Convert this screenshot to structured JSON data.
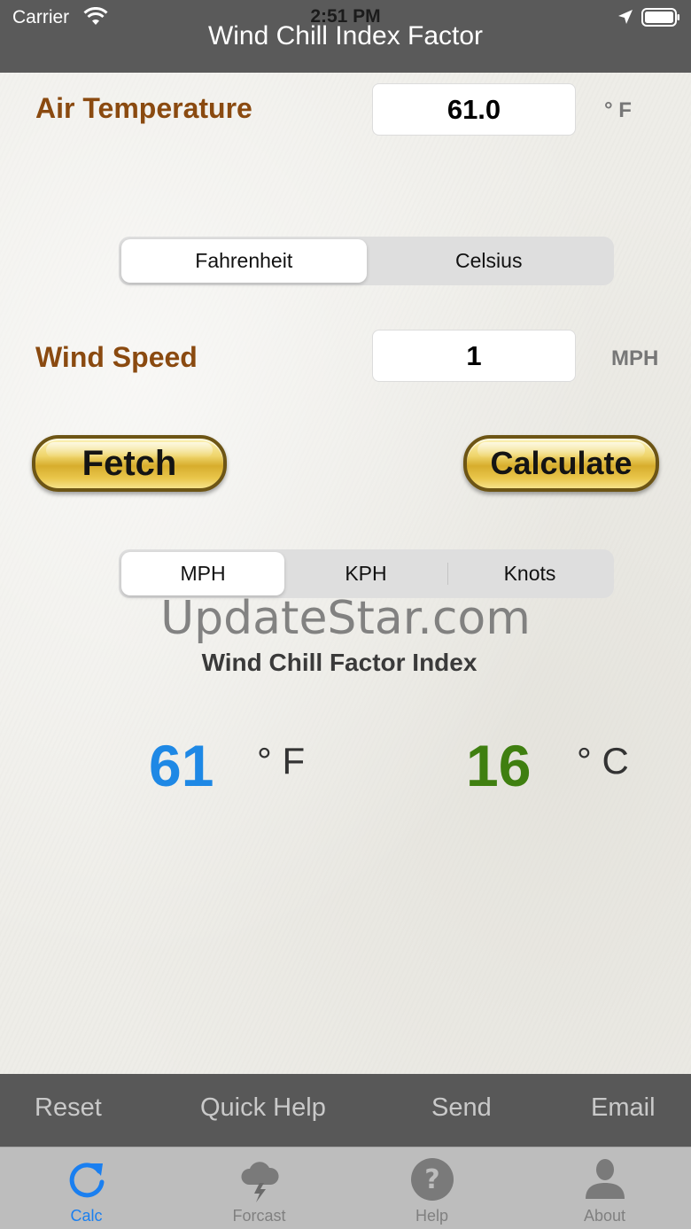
{
  "status_bar": {
    "carrier": "Carrier",
    "time": "2:51 PM"
  },
  "nav": {
    "title": "Wind Chill Index Factor"
  },
  "air_temperature": {
    "label": "Air Temperature",
    "value": "61.0",
    "unit": "° F"
  },
  "temp_units": {
    "options": [
      "Fahrenheit",
      "Celsius"
    ],
    "selected": "Fahrenheit"
  },
  "wind_speed": {
    "label": "Wind Speed",
    "value": "1",
    "unit": "MPH"
  },
  "buttons": {
    "fetch": "Fetch",
    "calculate": "Calculate"
  },
  "speed_units": {
    "options": [
      "MPH",
      "KPH",
      "Knots"
    ],
    "selected": "MPH"
  },
  "watermark": "UpdateStar.com",
  "result": {
    "title": "Wind Chill Factor Index",
    "fahrenheit_value": "61",
    "fahrenheit_unit": "° F",
    "celsius_value": "16",
    "celsius_unit": "° C"
  },
  "toolbar": {
    "reset": "Reset",
    "quick_help": "Quick Help",
    "send": "Send",
    "email": "Email"
  },
  "tabs": [
    {
      "label": "Calc",
      "icon": "refresh-icon",
      "active": true
    },
    {
      "label": "Forcast",
      "icon": "storm-cloud-icon",
      "active": false
    },
    {
      "label": "Help",
      "icon": "question-icon",
      "active": false
    },
    {
      "label": "About",
      "icon": "person-icon",
      "active": false
    }
  ],
  "colors": {
    "label_brown": "#8a4a10",
    "fahrenheit_blue": "#1e88e5",
    "celsius_green": "#3f7f10",
    "tab_active": "#1a7ff0"
  }
}
